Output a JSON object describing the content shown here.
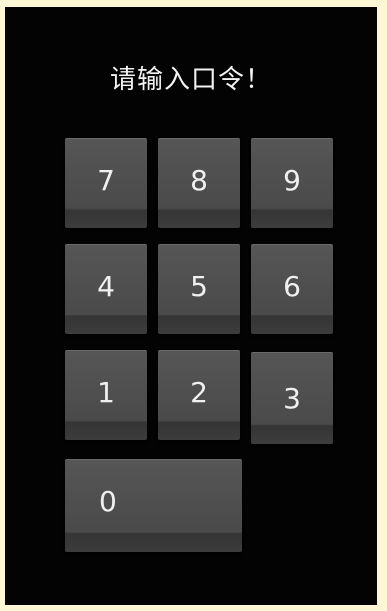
{
  "prompt": {
    "title": "请输入口令！"
  },
  "keypad": {
    "keys": [
      "7",
      "8",
      "9",
      "4",
      "5",
      "6",
      "1",
      "2",
      "3",
      "0"
    ]
  }
}
